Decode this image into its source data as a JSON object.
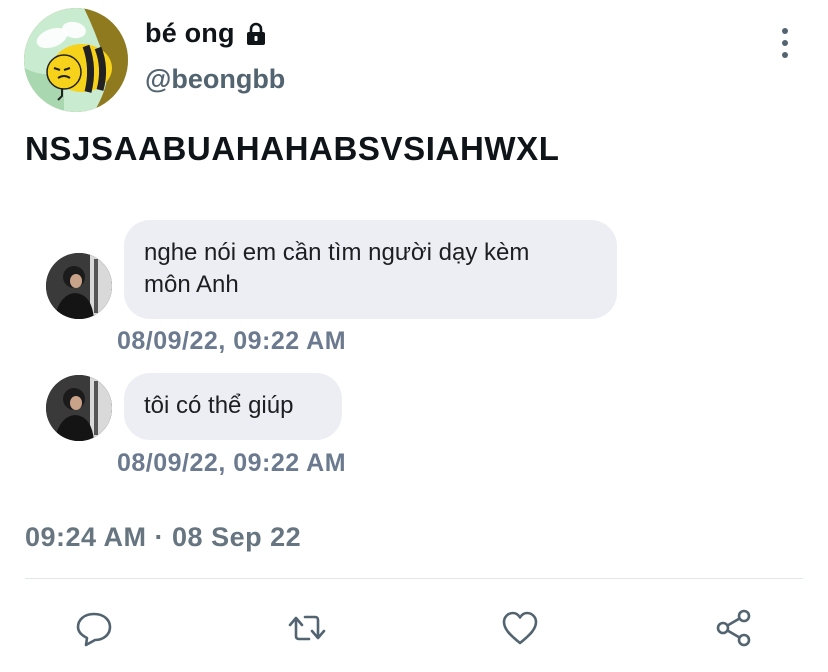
{
  "author": {
    "display_name": "bé ong",
    "handle": "@beongbb",
    "protected_icon": "lock-icon",
    "avatar_icon": "bee-avatar"
  },
  "tweet": {
    "text": "NSJSAABUAHAHABSVSIAHWXL",
    "timestamp": "09:24 AM · 08 Sep 22"
  },
  "messages": [
    {
      "text_line1": "nghe nói em cần tìm người dạy kèm",
      "text_line2": "môn Anh",
      "time": "08/09/22, 09:22 AM"
    },
    {
      "text": "tôi có thể giúp",
      "time": "08/09/22, 09:22 AM"
    }
  ],
  "actions": [
    "reply-icon",
    "retweet-icon",
    "like-icon",
    "share-icon"
  ],
  "colors": {
    "secondary_text": "#536471",
    "bubble_bg": "#edeef3",
    "stamp": "#6b7a8f"
  }
}
